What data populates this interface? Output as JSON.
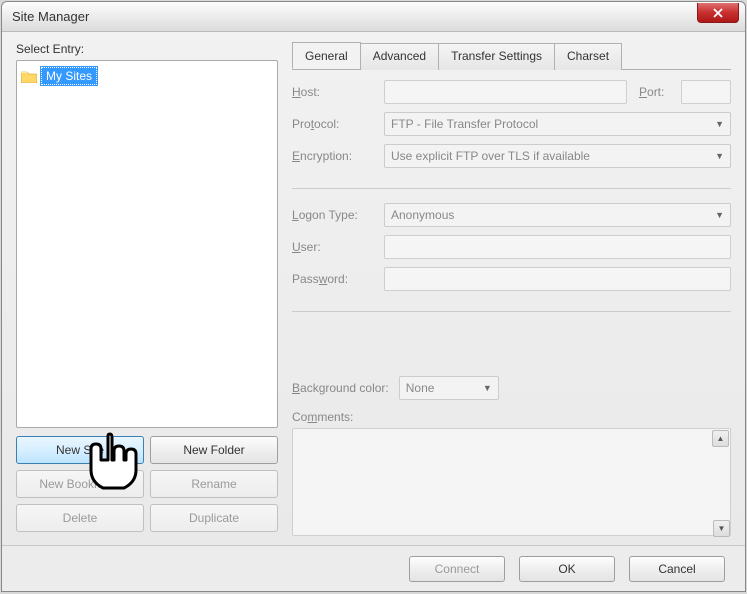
{
  "window": {
    "title": "Site Manager"
  },
  "left": {
    "selectLabel": "Select Entry:",
    "treeRoot": "My Sites",
    "buttons": {
      "newSite": "New Site",
      "newFolder": "New Folder",
      "newBookmark": "New Bookmark",
      "rename": "Rename",
      "delete": "Delete",
      "duplicate": "Duplicate"
    }
  },
  "tabs": [
    "General",
    "Advanced",
    "Transfer Settings",
    "Charset"
  ],
  "general": {
    "hostLabel": "Host:",
    "portLabel": "Port:",
    "protocolLabel": "Protocol:",
    "protocolValue": "FTP - File Transfer Protocol",
    "encryptionLabel": "Encryption:",
    "encryptionValue": "Use explicit FTP over TLS if available",
    "logonTypeLabel": "Logon Type:",
    "logonTypeValue": "Anonymous",
    "userLabel": "User:",
    "passwordLabel": "Password:",
    "bgColorLabel": "Background color:",
    "bgColorValue": "None",
    "commentsLabel": "Comments:"
  },
  "footer": {
    "connect": "Connect",
    "ok": "OK",
    "cancel": "Cancel"
  }
}
